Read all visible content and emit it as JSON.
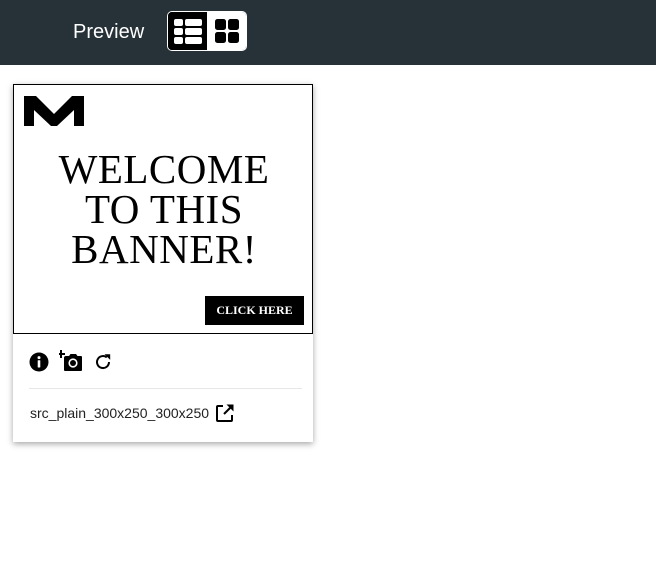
{
  "header": {
    "title": "Preview",
    "view_toggle": {
      "options": [
        "list-view",
        "grid-view"
      ],
      "selected": "grid-view"
    }
  },
  "card": {
    "banner": {
      "headline": [
        "WELCOME",
        "TO THIS",
        "BANNER!"
      ],
      "cta_label": "CLICK HERE",
      "logo_icon": "m-logo-icon"
    },
    "actions": [
      "info-icon",
      "add-screenshot-icon",
      "refresh-icon"
    ],
    "file_name": "src_plain_300x250_300x250",
    "open_icon": "open-external-icon"
  },
  "colors": {
    "topbar": "#263238",
    "accent": "#000000",
    "background": "#ffffff"
  }
}
